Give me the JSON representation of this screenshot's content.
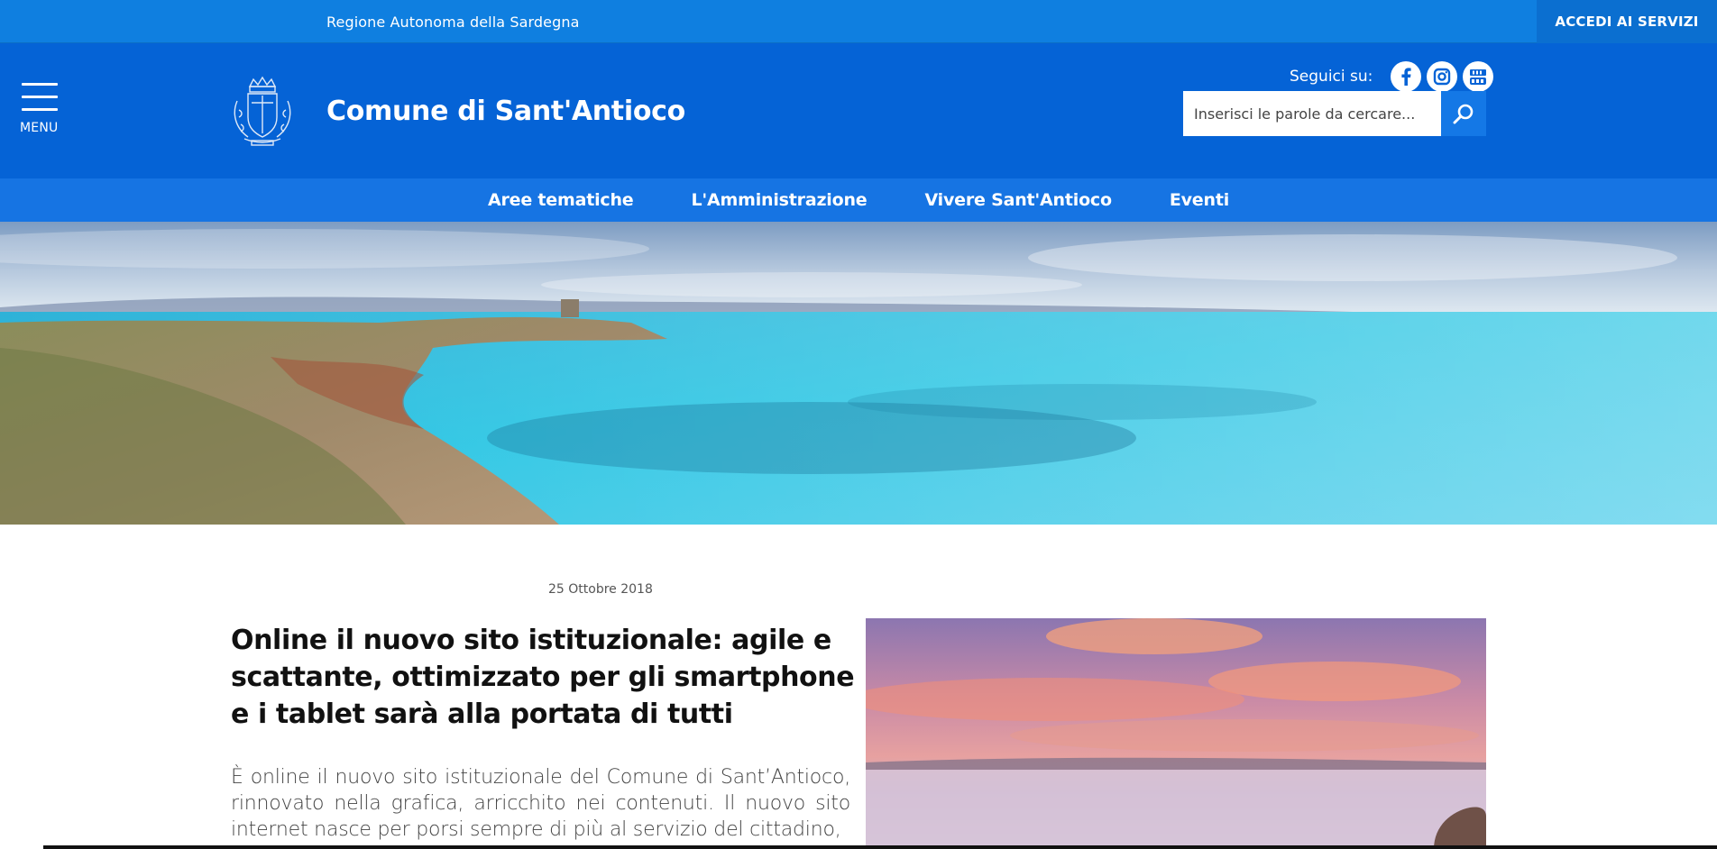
{
  "topbar": {
    "region_label": "Regione Autonoma della Sardegna",
    "services_label": "ACCEDI AI SERVIZI"
  },
  "header": {
    "menu_label": "MENU",
    "site_title": "Comune di Sant'Antioco",
    "follow_label": "Seguici su:",
    "social": [
      {
        "icon": "facebook-icon"
      },
      {
        "icon": "instagram-icon"
      },
      {
        "icon": "youtube-icon"
      }
    ],
    "search_placeholder": "Inserisci le parole da cercare..."
  },
  "nav": {
    "items": [
      {
        "label": "Aree tematiche"
      },
      {
        "label": "L'Amministrazione"
      },
      {
        "label": "Vivere Sant'Antioco"
      },
      {
        "label": "Eventi"
      }
    ]
  },
  "article": {
    "date": "25 Ottobre 2018",
    "title": "Online il nuovo sito istituzionale: agile e scattante, ottimizzato per gli smartphone e i tablet sarà alla portata di tutti",
    "body": "È online il nuovo sito istituzionale del Comune di Sant’Antioco, rinnovato nella grafica, arricchito nei contenuti. Il nuovo sito internet nasce per porsi sempre di più al servizio del cittadino,"
  },
  "colors": {
    "topbar": "#0f7fe0",
    "header": "#0563d6",
    "nav": "#1674e3",
    "services": "#0b6fd0"
  }
}
